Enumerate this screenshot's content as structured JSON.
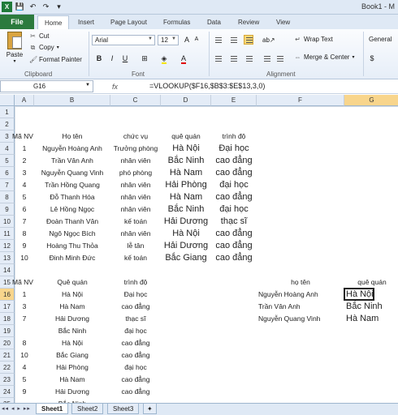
{
  "title_bar": {
    "window_title": "Book1 - M"
  },
  "tabs": {
    "file": "File",
    "items": [
      "Home",
      "Insert",
      "Page Layout",
      "Formulas",
      "Data",
      "Review",
      "View"
    ]
  },
  "ribbon": {
    "clipboard": {
      "paste": "Paste",
      "cut": "Cut",
      "copy": "Copy",
      "format_painter": "Format Painter",
      "label": "Clipboard"
    },
    "font": {
      "name": "Arial",
      "size": "12",
      "label": "Font",
      "bold": "B",
      "italic": "I",
      "underline": "U"
    },
    "alignment": {
      "wrap_text": "Wrap Text",
      "merge_center": "Merge & Center",
      "label": "Alignment"
    },
    "number": {
      "format": "General"
    }
  },
  "formula_bar": {
    "name_box": "G16",
    "fx": "fx",
    "formula": "=VLOOKUP($F16,$B$3:$E$13,3,0)"
  },
  "columns": [
    "A",
    "B",
    "C",
    "D",
    "E",
    "F",
    "G"
  ],
  "rows": [
    "1",
    "2",
    "3",
    "4",
    "5",
    "6",
    "7",
    "8",
    "9",
    "10",
    "11",
    "12",
    "13",
    "14",
    "15",
    "16",
    "17",
    "18",
    "19",
    "20",
    "21",
    "22",
    "23",
    "24",
    "25"
  ],
  "table1": {
    "headers": [
      "Mã NV",
      "Họ tên",
      "chức vụ",
      "quê quán",
      "trình độ"
    ],
    "rows": [
      [
        "1",
        "Nguyễn Hoàng Anh",
        "Trưởng phòng",
        "Hà Nội",
        "Đại học"
      ],
      [
        "2",
        "Trần Vân Anh",
        "nhân viên",
        "Bắc Ninh",
        "cao đẳng"
      ],
      [
        "3",
        "Nguyễn Quang Vinh",
        "phó phòng",
        "Hà Nam",
        "cao đẳng"
      ],
      [
        "4",
        "Trần Hồng Quang",
        "nhân viên",
        "Hải Phòng",
        "đại học"
      ],
      [
        "5",
        "Đỗ Thanh Hóa",
        "nhân viên",
        "Hà Nam",
        "cao đẳng"
      ],
      [
        "6",
        "Lê Hồng Ngọc",
        "nhân viên",
        "Bắc Ninh",
        "đại học"
      ],
      [
        "7",
        "Đoàn Thanh Vân",
        "kế toán",
        "Hải Dương",
        "thạc sĩ"
      ],
      [
        "8",
        "Ngô Ngọc Bích",
        "nhân viên",
        "Hà Nội",
        "cao đẳng"
      ],
      [
        "9",
        "Hoàng Thu Thỏa",
        "lễ tân",
        "Hải Dương",
        "cao đẳng"
      ],
      [
        "10",
        "Đinh Minh Đức",
        "kế toán",
        "Bắc Giang",
        "cao đẳng"
      ]
    ]
  },
  "table2": {
    "headers": [
      "Mã NV",
      "Quê quán",
      "trình độ"
    ],
    "rows": [
      [
        "1",
        "Hà Nội",
        "Đại học"
      ],
      [
        "3",
        "Hà Nam",
        "cao đẳng"
      ],
      [
        "7",
        "Hải Dương",
        "thạc sĩ"
      ],
      [
        "",
        "Bắc Ninh",
        "đại học"
      ],
      [
        "8",
        "Hà Nội",
        "cao đẳng"
      ],
      [
        "10",
        "Bắc Giang",
        "cao đẳng"
      ],
      [
        "4",
        "Hải Phòng",
        "đại học"
      ],
      [
        "5",
        "Hà Nam",
        "cao đẳng"
      ],
      [
        "9",
        "Hải Dương",
        "cao đẳng"
      ],
      [
        "",
        "Bắc Ninh",
        ""
      ]
    ]
  },
  "lookup": {
    "headers": [
      "họ tên",
      "quê quán"
    ],
    "rows": [
      [
        "Nguyễn Hoàng Anh",
        "Hà Nội"
      ],
      [
        "Trần Vân Anh",
        "Bắc Ninh"
      ],
      [
        "Nguyễn Quang Vinh",
        "Hà Nam"
      ]
    ]
  },
  "sheets": [
    "Sheet1",
    "Sheet2",
    "Sheet3"
  ]
}
